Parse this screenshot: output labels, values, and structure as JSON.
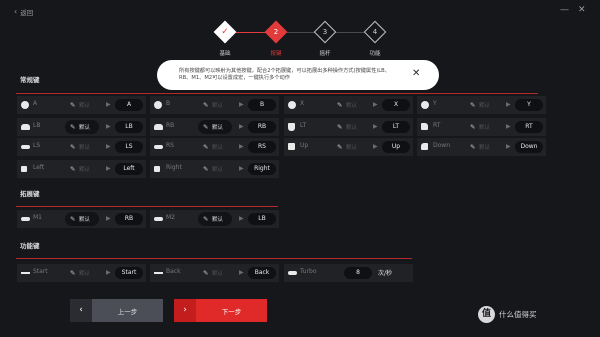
{
  "topbar": {
    "back_label": "返回",
    "minimize": "—",
    "close": "✕"
  },
  "stepper": {
    "steps": [
      {
        "num": "✓",
        "label": "基础"
      },
      {
        "num": "2",
        "label": "按键"
      },
      {
        "num": "3",
        "label": "摇杆"
      },
      {
        "num": "4",
        "label": "功能"
      }
    ]
  },
  "notice": {
    "text": "所有按键都可以映射为其他按键，配合2个拓展键，可以拓展出多种操作方式(按键属性)LB、RB、M1、M2可以设置成宏，一键执行多个动作",
    "close": "✕"
  },
  "sections": {
    "common": "常规键",
    "extend": "拓展键",
    "function": "功能键"
  },
  "common_keys": [
    {
      "name": "A",
      "default": "默认",
      "value": "A"
    },
    {
      "name": "B",
      "default": "默认",
      "value": "B"
    },
    {
      "name": "X",
      "default": "默认",
      "value": "X"
    },
    {
      "name": "Y",
      "default": "默认",
      "value": "Y"
    },
    {
      "name": "LB",
      "default": "默认",
      "value": "LB"
    },
    {
      "name": "RB",
      "default": "默认",
      "value": "RB"
    },
    {
      "name": "LT",
      "default": "默认",
      "value": "LT"
    },
    {
      "name": "RT",
      "default": "默认",
      "value": "RT"
    },
    {
      "name": "LS",
      "default": "默认",
      "value": "LS"
    },
    {
      "name": "RS",
      "default": "默认",
      "value": "RS"
    },
    {
      "name": "Up",
      "default": "默认",
      "value": "Up"
    },
    {
      "name": "Down",
      "default": "默认",
      "value": "Down"
    },
    {
      "name": "Left",
      "default": "默认",
      "value": "Left"
    },
    {
      "name": "Right",
      "default": "默认",
      "value": "Right"
    }
  ],
  "extend_keys": [
    {
      "name": "M1",
      "default": "默认",
      "value": "RB"
    },
    {
      "name": "M2",
      "default": "默认",
      "value": "LB"
    }
  ],
  "function_keys": [
    {
      "name": "Start",
      "default": "默认",
      "value": "Start"
    },
    {
      "name": "Back",
      "default": "默认",
      "value": "Back"
    },
    {
      "name": "Turbo",
      "value": "8",
      "unit": "次/秒"
    }
  ],
  "nav": {
    "prev": "上一步",
    "next": "下一步",
    "prev_icon": "‹",
    "next_icon": "›"
  },
  "watermark": {
    "logo": "值",
    "text": "什么值得买"
  },
  "colors": {
    "accent": "#e02a2a",
    "background": "#16171b",
    "cell": "#212226"
  }
}
